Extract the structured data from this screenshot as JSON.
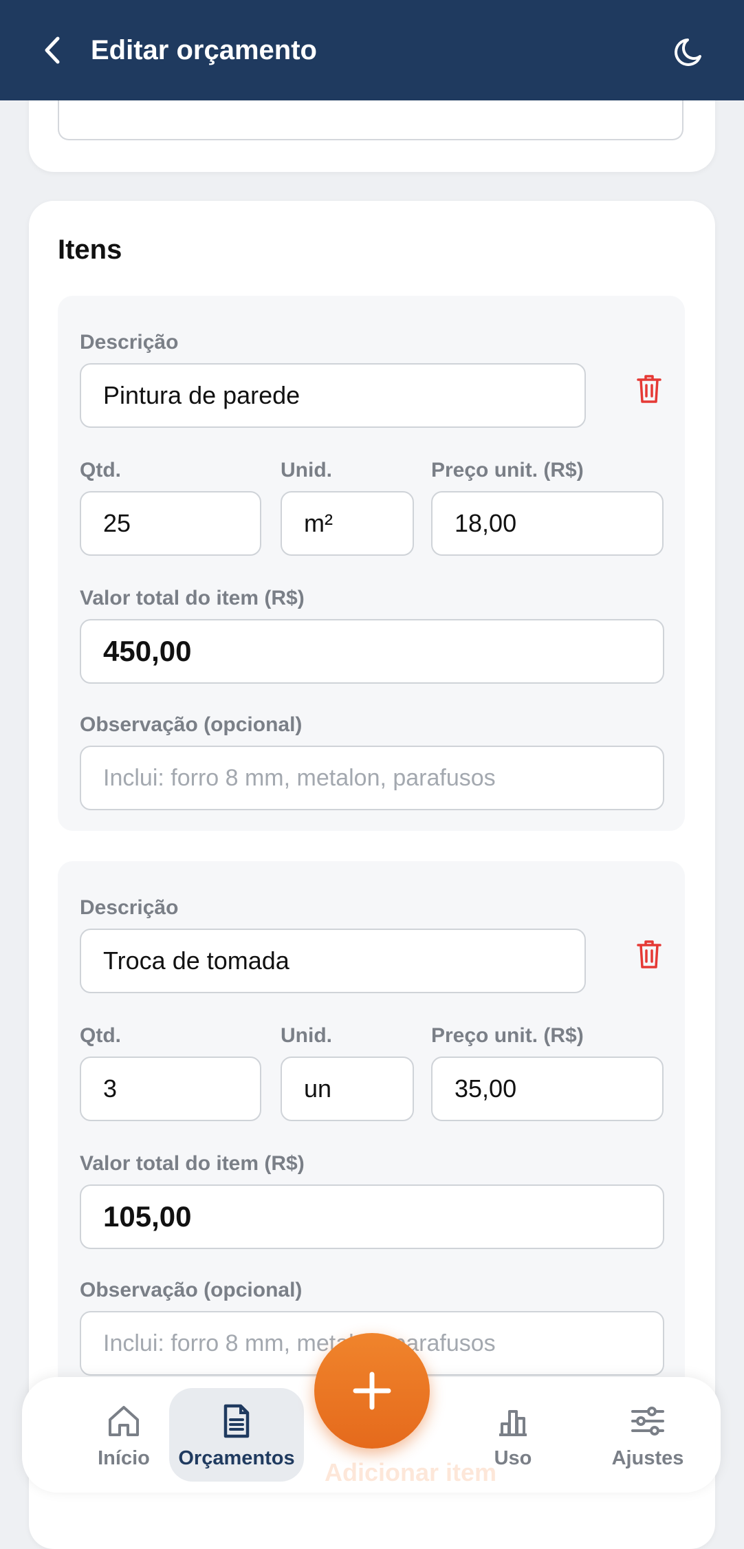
{
  "header": {
    "title": "Editar orçamento",
    "back_icon": "chevron-left-icon",
    "theme_icon": "moon-icon"
  },
  "items_section": {
    "title": "Itens",
    "labels": {
      "description": "Descrição",
      "qty": "Qtd.",
      "unit": "Unid.",
      "unit_price": "Preço unit. (R$)",
      "total": "Valor total do item (R$)",
      "note": "Observação (opcional)"
    },
    "note_placeholder": "Inclui: forro 8 mm, metalon, parafusos",
    "items": [
      {
        "description": "Pintura de parede",
        "qty": "25",
        "unit": "m²",
        "unit_price": "18,00",
        "total": "450,00",
        "note": ""
      },
      {
        "description": "Troca de tomada",
        "qty": "3",
        "unit": "un",
        "unit_price": "35,00",
        "total": "105,00",
        "note": ""
      }
    ],
    "add_item_label": "Adicionar item"
  },
  "fab": {
    "icon": "plus-icon"
  },
  "bottom_nav": {
    "items": [
      {
        "label": "Início",
        "icon": "home-icon",
        "active": false
      },
      {
        "label": "Orçamentos",
        "icon": "document-icon",
        "active": true
      },
      {
        "label": "Uso",
        "icon": "bar-chart-icon",
        "active": false
      },
      {
        "label": "Ajustes",
        "icon": "sliders-icon",
        "active": false
      }
    ]
  },
  "colors": {
    "header_bg": "#1f3a5f",
    "accent": "#ef7c2a",
    "danger": "#e53935",
    "page_bg": "#eef0f3"
  }
}
